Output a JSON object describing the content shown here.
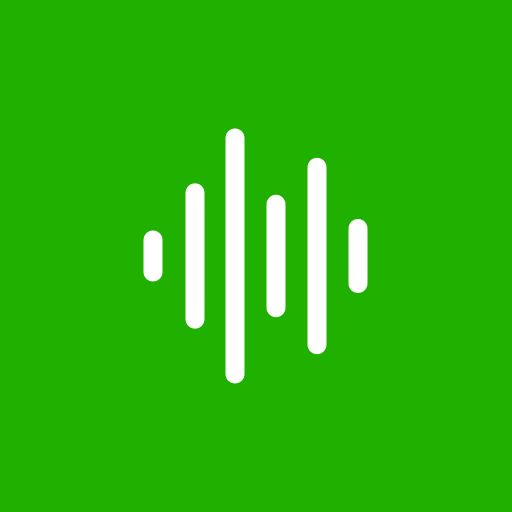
{
  "app_icon": {
    "icon": "sound-waveform-icon",
    "background_color": "#20b000",
    "bar_color": "#ffffff",
    "bar_levels": [
      0.2,
      0.57,
      1.0,
      0.48,
      0.77,
      0.29
    ]
  }
}
